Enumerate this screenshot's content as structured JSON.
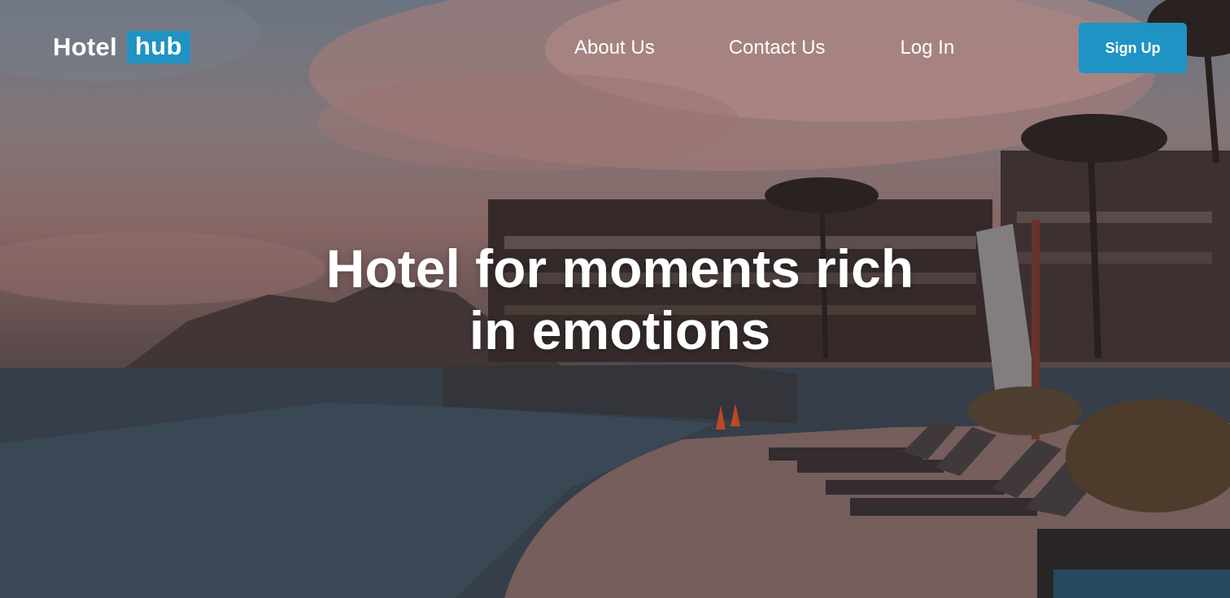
{
  "logo": {
    "text_primary": "Hotel",
    "text_highlight": "hub"
  },
  "nav": {
    "items": [
      {
        "label": "About Us"
      },
      {
        "label": "Contact Us"
      },
      {
        "label": "Log In"
      }
    ],
    "signup_label": "Sign Up"
  },
  "hero": {
    "headline_line1": "Hotel for moments rich",
    "headline_line2": "in emotions"
  },
  "colors": {
    "accent": "#1f93c4",
    "text": "#ffffff"
  }
}
